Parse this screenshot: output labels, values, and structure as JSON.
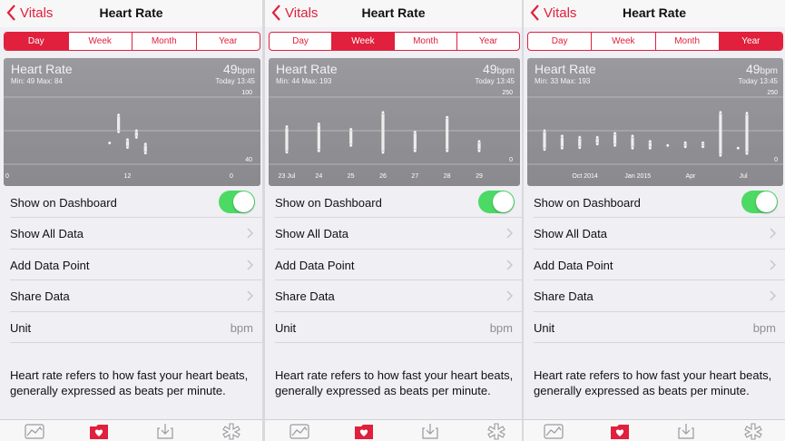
{
  "colors": {
    "accent": "#e0203c",
    "toggle_on": "#4cd964",
    "chart_bg": "#8e8e92",
    "secondary_text": "#8e8e93"
  },
  "icons": {
    "back": "chevron-left-icon",
    "row": "chevron-right-icon",
    "tabs": [
      "dashboard-icon",
      "health-data-icon",
      "sources-icon",
      "medical-id-icon"
    ]
  },
  "screens": [
    {
      "nav": {
        "back_label": "Vitals",
        "title": "Heart Rate"
      },
      "segments": [
        "Day",
        "Week",
        "Month",
        "Year"
      ],
      "active_segment": 0,
      "summary": {
        "title": "Heart Rate",
        "minmax": "Min: 49  Max: 84",
        "value": "49",
        "unit": "bpm",
        "today": "Today 13:45"
      },
      "rows": {
        "dashboard": "Show on Dashboard",
        "all_data": "Show All Data",
        "add_point": "Add Data Point",
        "share": "Share Data",
        "unit_label": "Unit",
        "unit_value": "bpm"
      },
      "show_on_dashboard": true,
      "description": "Heart rate refers to how fast your heart beats, generally expressed as beats per minute."
    },
    {
      "nav": {
        "back_label": "Vitals",
        "title": "Heart Rate"
      },
      "segments": [
        "Day",
        "Week",
        "Month",
        "Year"
      ],
      "active_segment": 1,
      "summary": {
        "title": "Heart Rate",
        "minmax": "Min: 44  Max: 193",
        "value": "49",
        "unit": "bpm",
        "today": "Today 13:45"
      },
      "rows": {
        "dashboard": "Show on Dashboard",
        "all_data": "Show All Data",
        "add_point": "Add Data Point",
        "share": "Share Data",
        "unit_label": "Unit",
        "unit_value": "bpm"
      },
      "show_on_dashboard": true,
      "description": "Heart rate refers to how fast your heart beats, generally expressed as beats per minute."
    },
    {
      "nav": {
        "back_label": "Vitals",
        "title": "Heart Rate"
      },
      "segments": [
        "Day",
        "Week",
        "Month",
        "Year"
      ],
      "active_segment": 3,
      "summary": {
        "title": "Heart Rate",
        "minmax": "Min: 33  Max: 193",
        "value": "49",
        "unit": "bpm",
        "today": "Today 13:45"
      },
      "rows": {
        "dashboard": "Show on Dashboard",
        "all_data": "Show All Data",
        "add_point": "Add Data Point",
        "share": "Share Data",
        "unit_label": "Unit",
        "unit_value": "bpm"
      },
      "show_on_dashboard": true,
      "description": "Heart rate refers to how fast your heart beats, generally expressed as beats per minute."
    }
  ],
  "chart_data": [
    {
      "type": "scatter",
      "x_ticks": [
        "0",
        "12",
        "0"
      ],
      "x_range": [
        0,
        24
      ],
      "ylim": [
        40,
        100
      ],
      "y_ticks": [
        "100",
        "40"
      ],
      "ranges": [
        {
          "x": 10,
          "low": 59,
          "high": 59
        },
        {
          "x": 11,
          "low": 69,
          "high": 84
        },
        {
          "x": 12,
          "low": 55,
          "high": 62
        },
        {
          "x": 13,
          "low": 64,
          "high": 70
        },
        {
          "x": 14,
          "low": 50,
          "high": 58
        }
      ]
    },
    {
      "type": "scatter",
      "x_ticks": [
        "23 Jul",
        "24",
        "25",
        "26",
        "27",
        "28",
        "29"
      ],
      "x_range": [
        0,
        6
      ],
      "ylim": [
        0,
        250
      ],
      "y_ticks": [
        "250",
        "0"
      ],
      "ranges": [
        {
          "x": 0,
          "low": 45,
          "high": 140
        },
        {
          "x": 1,
          "low": 50,
          "high": 150
        },
        {
          "x": 2,
          "low": 70,
          "high": 130
        },
        {
          "x": 3,
          "low": 44,
          "high": 193
        },
        {
          "x": 4,
          "low": 50,
          "high": 120
        },
        {
          "x": 5,
          "low": 50,
          "high": 175
        },
        {
          "x": 6,
          "low": 50,
          "high": 85
        }
      ]
    },
    {
      "type": "scatter",
      "x_ticks": [
        "Oct 2014",
        "Jan 2015",
        "Apr",
        "Jul"
      ],
      "x_tick_positions": [
        2.3,
        5.3,
        8.3,
        11.3
      ],
      "x_range": [
        0,
        11.5
      ],
      "ylim": [
        0,
        250
      ],
      "y_ticks": [
        "250",
        "0"
      ],
      "ranges": [
        {
          "x": 0,
          "low": 55,
          "high": 125
        },
        {
          "x": 1,
          "low": 60,
          "high": 105
        },
        {
          "x": 2,
          "low": 62,
          "high": 100
        },
        {
          "x": 3,
          "low": 75,
          "high": 100
        },
        {
          "x": 4,
          "low": 70,
          "high": 115
        },
        {
          "x": 5,
          "low": 60,
          "high": 105
        },
        {
          "x": 6,
          "low": 60,
          "high": 85
        },
        {
          "x": 7,
          "low": 70,
          "high": 70
        },
        {
          "x": 8,
          "low": 65,
          "high": 80
        },
        {
          "x": 9,
          "low": 65,
          "high": 80
        },
        {
          "x": 10,
          "low": 33,
          "high": 193
        },
        {
          "x": 11,
          "low": 60,
          "high": 60
        },
        {
          "x": 11.5,
          "low": 40,
          "high": 190
        }
      ]
    }
  ]
}
